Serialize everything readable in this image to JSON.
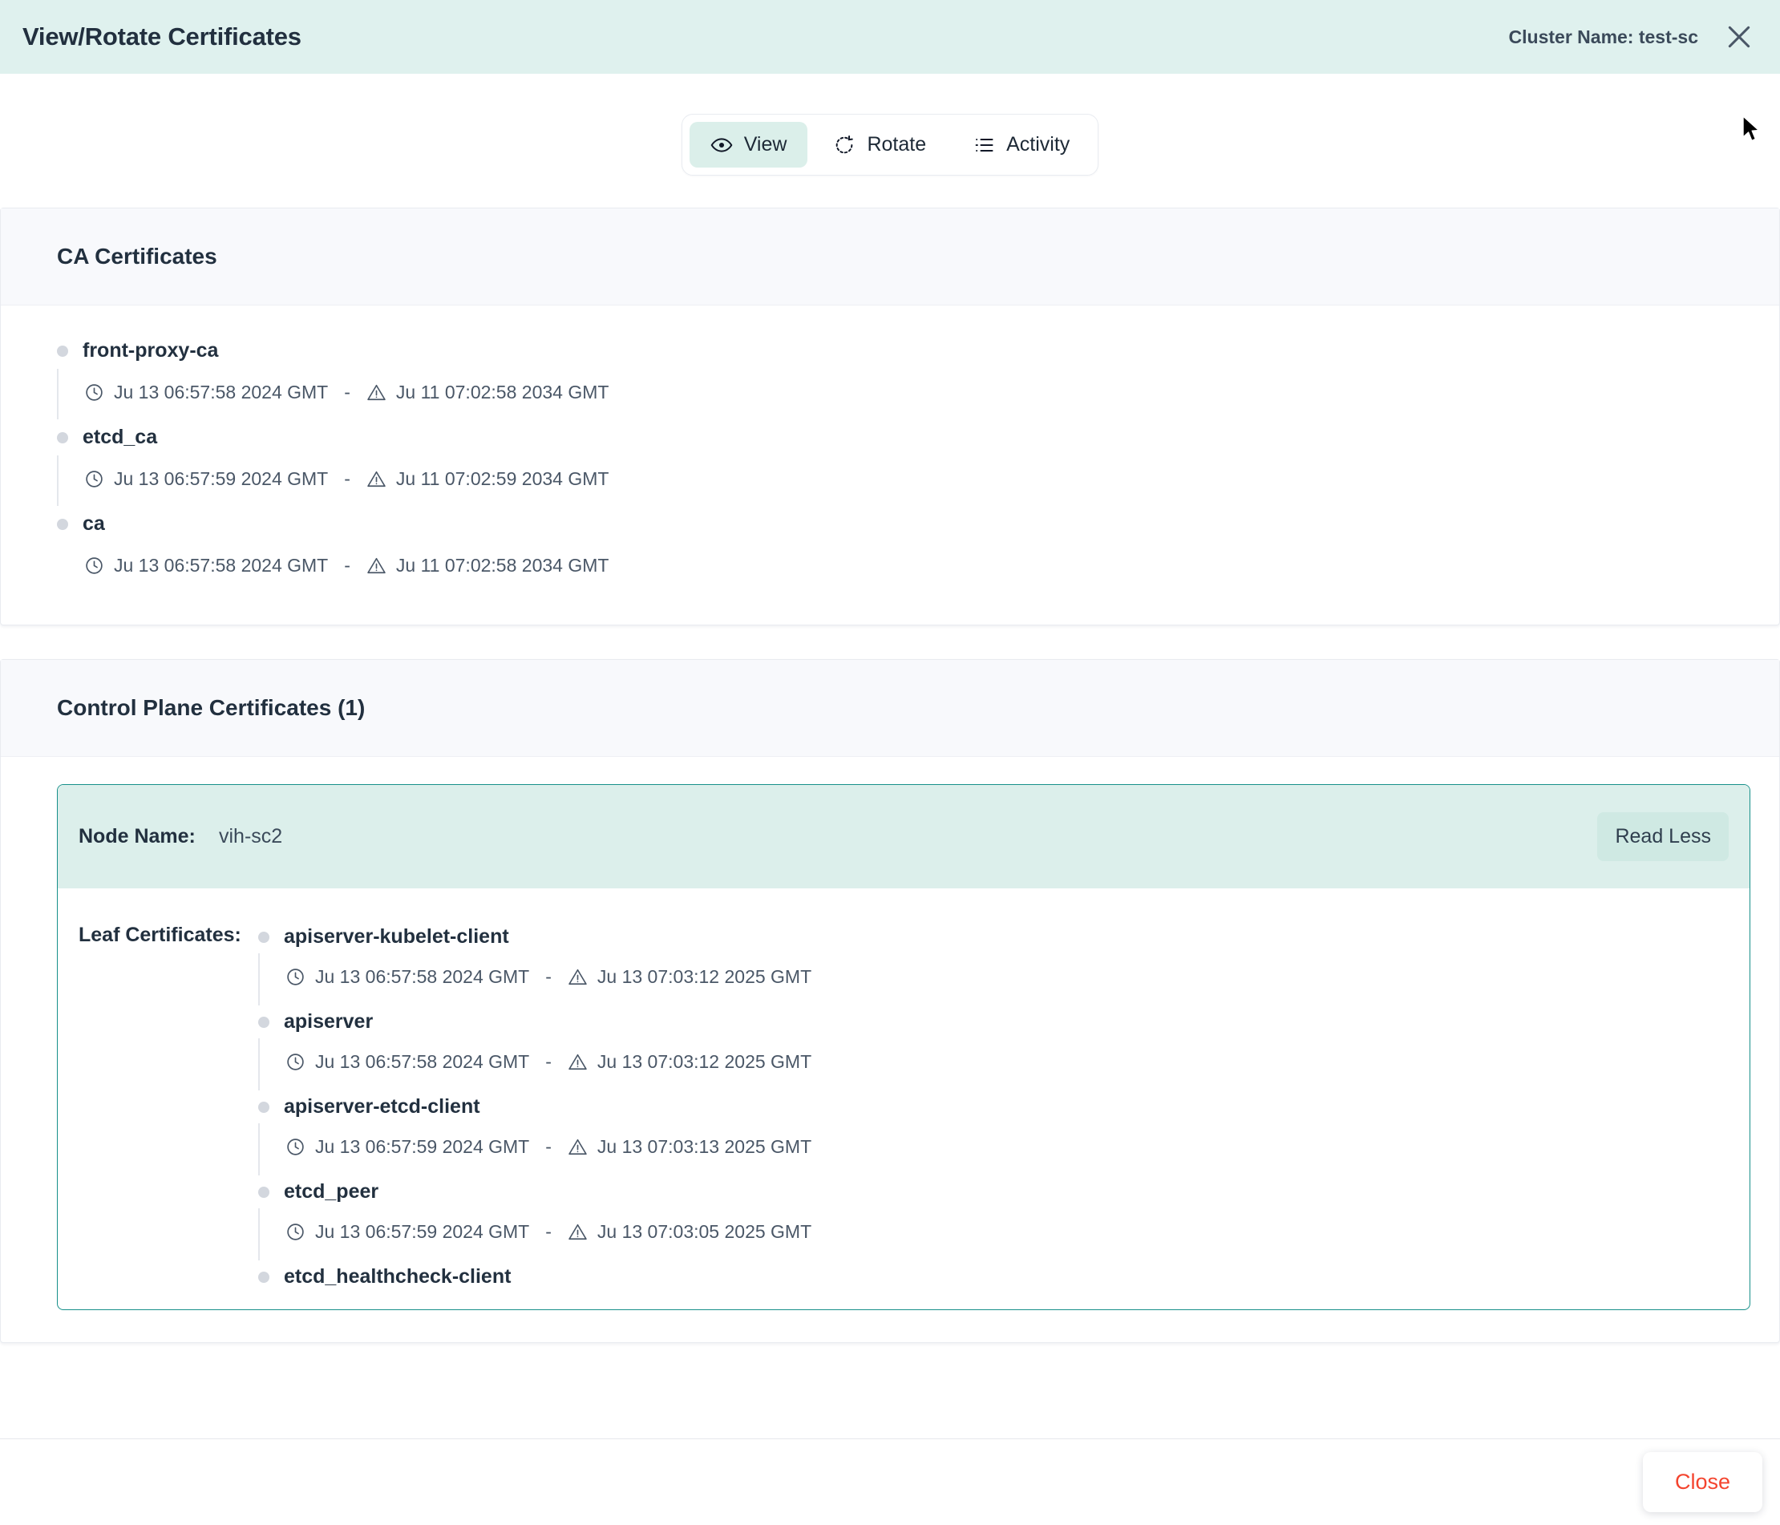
{
  "header": {
    "title": "View/Rotate Certificates",
    "cluster_label": "Cluster Name: test-sc",
    "close_icon": "close-icon"
  },
  "tabs": [
    {
      "label": "View",
      "icon": "eye-icon",
      "active": true
    },
    {
      "label": "Rotate",
      "icon": "rotate-dashed-icon",
      "active": false
    },
    {
      "label": "Activity",
      "icon": "list-icon",
      "active": false
    }
  ],
  "ca_section": {
    "title": "CA Certificates",
    "certificates": [
      {
        "name": "front-proxy-ca",
        "not_before": "Ju 13 06:57:58 2024 GMT",
        "separator": "-",
        "not_after": "Ju 11 07:02:58 2034 GMT"
      },
      {
        "name": "etcd_ca",
        "not_before": "Ju 13 06:57:59 2024 GMT",
        "separator": "-",
        "not_after": "Ju 11 07:02:59 2034 GMT"
      },
      {
        "name": "ca",
        "not_before": "Ju 13 06:57:58 2024 GMT",
        "separator": "-",
        "not_after": "Ju 11 07:02:58 2034 GMT"
      }
    ]
  },
  "control_plane_section": {
    "title": "Control Plane Certificates (1)",
    "node": {
      "node_name_label": "Node Name:",
      "node_name_value": "vih-sc2",
      "read_less_label": "Read Less",
      "leaf_label": "Leaf Certificates:",
      "leaf_certificates": [
        {
          "name": "apiserver-kubelet-client",
          "not_before": "Ju 13 06:57:58 2024 GMT",
          "separator": "-",
          "not_after": "Ju 13 07:03:12 2025 GMT"
        },
        {
          "name": "apiserver",
          "not_before": "Ju 13 06:57:58 2024 GMT",
          "separator": "-",
          "not_after": "Ju 13 07:03:12 2025 GMT"
        },
        {
          "name": "apiserver-etcd-client",
          "not_before": "Ju 13 06:57:59 2024 GMT",
          "separator": "-",
          "not_after": "Ju 13 07:03:13 2025 GMT"
        },
        {
          "name": "etcd_peer",
          "not_before": "Ju 13 06:57:59 2024 GMT",
          "separator": "-",
          "not_after": "Ju 13 07:03:05 2025 GMT"
        },
        {
          "name": "etcd_healthcheck-client",
          "not_before": "",
          "separator": "",
          "not_after": ""
        }
      ]
    }
  },
  "footer": {
    "close_label": "Close"
  },
  "colors": {
    "header_bg": "#dff1ee",
    "accent_teal": "#17908a",
    "node_head_bg": "#dcefeb",
    "tab_active_bg": "#dbefea",
    "section_head_bg": "#f8f9fc",
    "close_text": "#f4442e",
    "text_primary": "#22303f",
    "text_secondary": "#4a5767",
    "bullet": "#d3d7de"
  }
}
